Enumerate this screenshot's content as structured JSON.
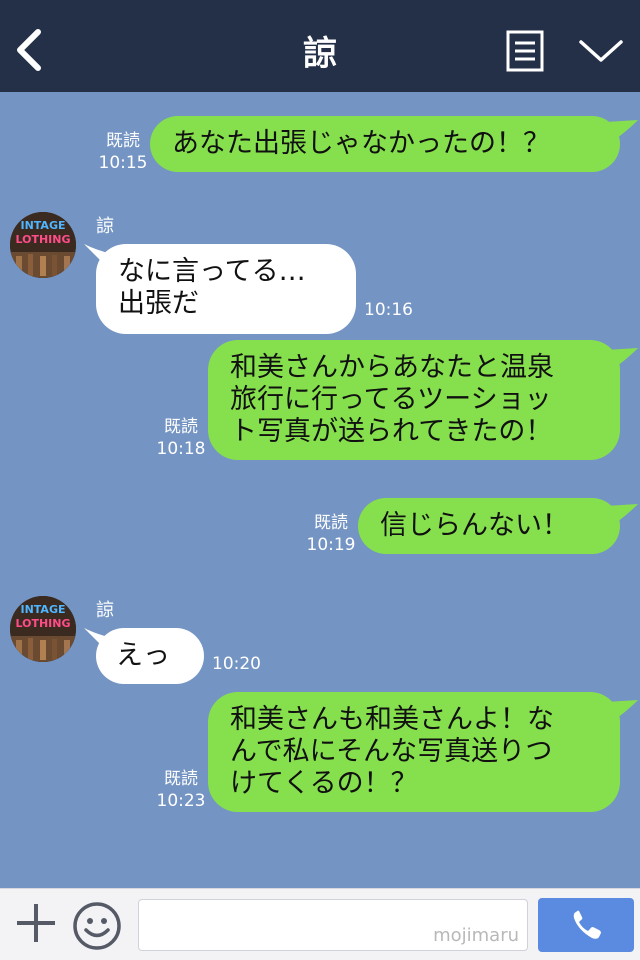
{
  "header": {
    "title": "諒",
    "back_icon": "chevron-left-icon",
    "menu_icon": "list-icon",
    "down_icon": "chevron-down-icon"
  },
  "messages": [
    {
      "dir": "out",
      "text": "あなた出張じゃなかったの！？",
      "read": "既読",
      "time": "10:15"
    },
    {
      "dir": "in",
      "sender": "諒",
      "text": "なに言ってる…\n出張だ",
      "time": "10:16"
    },
    {
      "dir": "out",
      "text": "和美さんからあなたと温泉\n旅行に行ってるツーショッ\nト写真が送られてきたの！",
      "read": "既読",
      "time": "10:18"
    },
    {
      "dir": "out",
      "text": "信じらんない！",
      "read": "既読",
      "time": "10:19"
    },
    {
      "dir": "in",
      "sender": "諒",
      "text": "えっ",
      "time": "10:20"
    },
    {
      "dir": "out",
      "text": "和美さんも和美さんよ！な\nんで私にそんな写真送りつ\nけてくるの！？",
      "read": "既読",
      "time": "10:23"
    }
  ],
  "avatar": {
    "lines": [
      "INTAGE",
      "LOTHING"
    ]
  },
  "input": {
    "watermark": "mojimaru"
  },
  "colors": {
    "header_bg": "#242f48",
    "chat_bg": "#7494c3",
    "out_bubble": "#86e04d",
    "in_bubble": "#ffffff",
    "call_button": "#5b8be0"
  }
}
